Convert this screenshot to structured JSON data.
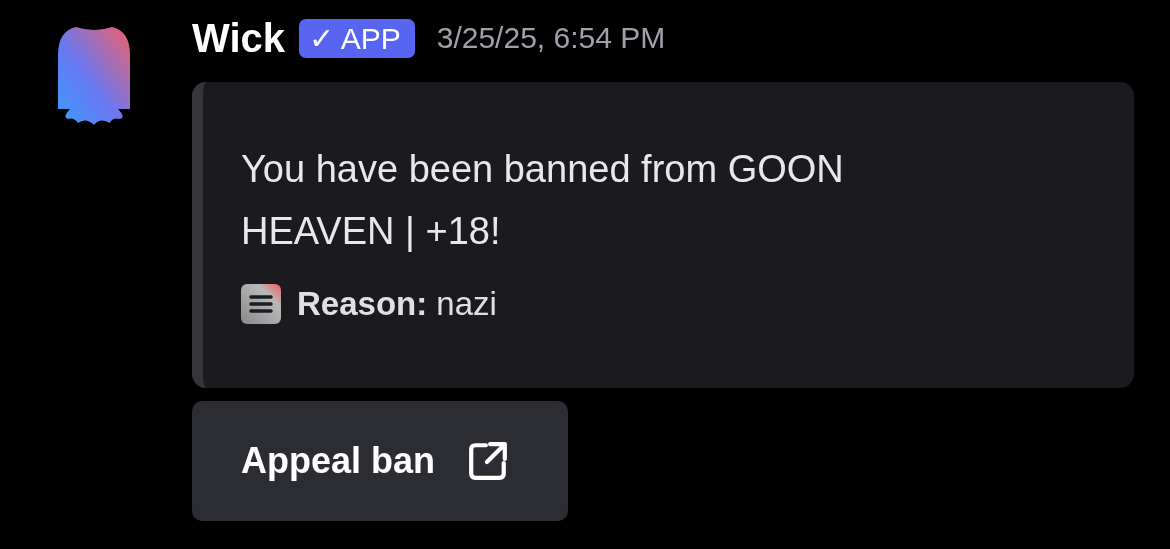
{
  "message": {
    "author": "Wick",
    "badge": {
      "check": "✓",
      "label": "APP"
    },
    "timestamp": "3/25/25, 6:54 PM"
  },
  "embed": {
    "description": "You have been banned from GOON HEAVEN | +18!",
    "reason": "**Reason:** nazi"
  },
  "buttons": [
    {
      "label": "Appeal ban"
    }
  ]
}
